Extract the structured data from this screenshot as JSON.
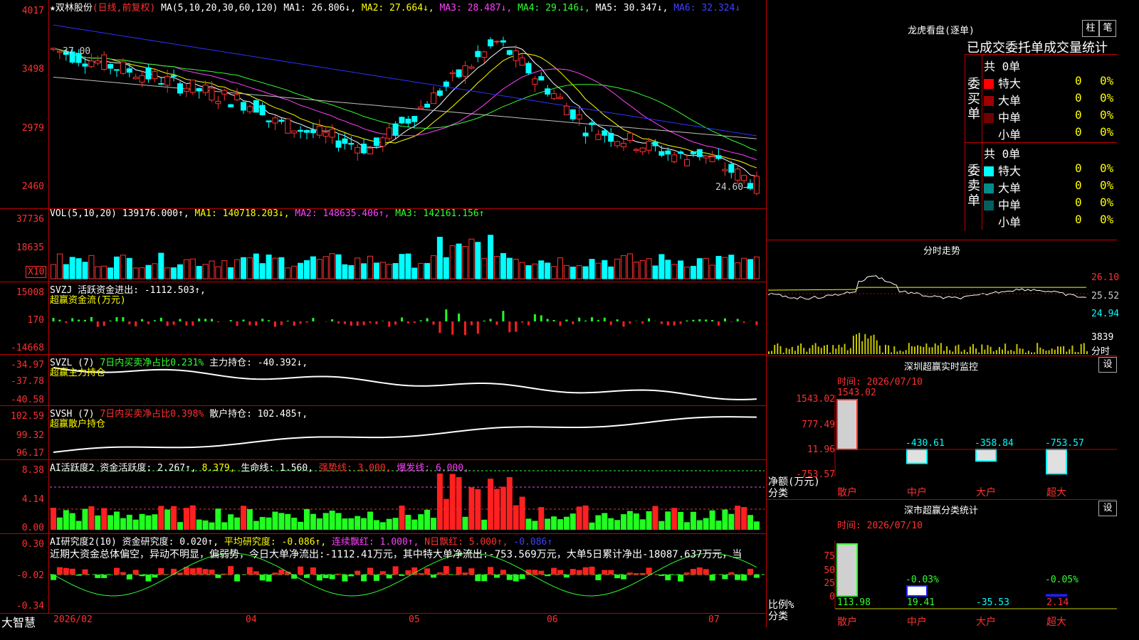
{
  "stock": {
    "name_label": "★双林股份",
    "mode_label": "(日线,前复权)",
    "ma_header": {
      "prefix": "MA(5,10,20,30,60,120)",
      "ma1": "MA1: 26.806↓,",
      "ma2": "MA2: 27.664↓,",
      "ma3": "MA3: 28.487↓,",
      "ma4": "MA4: 29.146↓,",
      "ma5": "MA5: 30.347↓,",
      "ma6": "MA6: 32.324↓"
    },
    "price_axis": [
      "4017",
      "3498",
      "2979",
      "2460"
    ],
    "high_marker": "37.00",
    "low_marker": "24.60→"
  },
  "volume": {
    "header": {
      "prefix": "VOL(5,10,20)",
      "vol": "139176.000↑,",
      "ma1": "MA1: 140718.203↓,",
      "ma2": "MA2: 148635.406↑,",
      "ma3": "MA3: 142161.156↑"
    },
    "axis": [
      "37736",
      "18635"
    ],
    "unit_label": "X10"
  },
  "svzj": {
    "line1_prefix": "SVZJ",
    "line1_label": "活跃资金进出: -1112.503↑,",
    "line2": "超赢资金流(万元)",
    "axis": [
      "15008",
      "170",
      "-14668"
    ]
  },
  "svzl": {
    "prefix": "SVZL (7)",
    "ratio": "7日内买卖净占比0.231%",
    "hold": "主力持仓: -40.392↓,",
    "line2": "超赢主力持仓",
    "axis": [
      "-34.97",
      "-37.78",
      "-40.58"
    ]
  },
  "svsh": {
    "prefix": "SVSH (7)",
    "ratio": "7日内买卖净占比0.398%",
    "hold": "散户持仓: 102.485↑,",
    "line2": "超赢散户持仓",
    "axis": [
      "102.59",
      "99.32",
      "96.17"
    ]
  },
  "ai_active": {
    "prefix": "AI活跃度2",
    "active": "资金活跃度: 2.267↑,",
    "v2": "8.379,",
    "life": "生命线: 1.560,",
    "strong": "强势线: 3.000,",
    "burst": "爆发线: 6.000,",
    "axis": [
      "8.38",
      "4.14",
      "0.00"
    ]
  },
  "ai_research": {
    "prefix": "AI研究度2(10)",
    "degree": "资金研究度: 0.020↑,",
    "avg": "平均研究度: -0.086↑,",
    "red_cont": "连续飘红: 1.000↑,",
    "n_red": "N日飘红: 5.000↑,",
    "neg": "-0.086↑",
    "summary": "近期大资金总体偏空，异动不明显，偏弱势，今日大单净流出:-1112.41万元，其中特大单净流出:-753.569万元，大单5日累计净出-18087.637万元，当",
    "axis": [
      "0.30",
      "-0.02",
      "-0.34"
    ]
  },
  "date_axis": [
    "2026/02",
    "04",
    "05",
    "06",
    "07"
  ],
  "brand": "大智慧",
  "dragon": {
    "title": "龙虎看盘(逐单)",
    "btn_a": "柱",
    "btn_b": "笔",
    "tabs": "已成交委托单成交量统计",
    "buy_total": "共 0单",
    "sell_total": "共 0单",
    "buy_side": "委买单",
    "sell_side": "委卖单",
    "rows_buy": [
      {
        "label": "特大",
        "count": "0",
        "pct": "0%",
        "color": "#ff0000"
      },
      {
        "label": "大单",
        "count": "0",
        "pct": "0%",
        "color": "#a00000"
      },
      {
        "label": "中单",
        "count": "0",
        "pct": "0%",
        "color": "#700000"
      },
      {
        "label": "小单",
        "count": "0",
        "pct": "0%",
        "color": "#000000"
      }
    ],
    "rows_sell": [
      {
        "label": "特大",
        "count": "0",
        "pct": "0%",
        "color": "#00ffff"
      },
      {
        "label": "大单",
        "count": "0",
        "pct": "0%",
        "color": "#008c8c"
      },
      {
        "label": "中单",
        "count": "0",
        "pct": "0%",
        "color": "#006060"
      },
      {
        "label": "小单",
        "count": "0",
        "pct": "0%",
        "color": "#000000"
      }
    ]
  },
  "intraday": {
    "title": "分时走势",
    "prices": [
      "26.10",
      "25.52",
      "24.94"
    ],
    "vol": "3839",
    "vol_unit": "分时"
  },
  "monitor": {
    "title": "深圳超赢实时监控",
    "btn": "设",
    "time": "时间: 2026/07/10",
    "top_value": "1543.02",
    "axis": [
      "1543.02",
      "777.49",
      "11.96",
      "-753.57"
    ],
    "unit": "净额(万元)",
    "cat_label": "分类",
    "bars": [
      {
        "label": "散户",
        "value": 1543.02,
        "text": ""
      },
      {
        "label": "中户",
        "value": -430.61,
        "text": "-430.61"
      },
      {
        "label": "大户",
        "value": -358.84,
        "text": "-358.84"
      },
      {
        "label": "超大",
        "value": -753.57,
        "text": "-753.57"
      }
    ]
  },
  "classify": {
    "title": "深市超赢分类统计",
    "btn": "设",
    "time": "时间: 2026/07/10",
    "axis": [
      "75",
      "50",
      "25",
      "0"
    ],
    "unit": "比例%",
    "cat_label": "分类",
    "bars": [
      {
        "label": "散户",
        "pct": 113.98,
        "top_text": "",
        "bottom": "113.98"
      },
      {
        "label": "中户",
        "pct": 19.41,
        "top_text": "-0.03%",
        "bottom": "19.41"
      },
      {
        "label": "大户",
        "pct": -35.53,
        "top_text": "",
        "bottom": "-35.53"
      },
      {
        "label": "超大",
        "pct": 2.14,
        "top_text": "-0.05%",
        "bottom": "2.14"
      }
    ]
  },
  "colors": {
    "up": "#ff3030",
    "down": "#00ffff",
    "ma1": "#ffffff",
    "ma2": "#ffff00",
    "ma3": "#ff40ff",
    "ma4": "#30ff30",
    "ma5": "#c0c0c0",
    "ma6": "#3030ff",
    "grid": "#c00000"
  }
}
